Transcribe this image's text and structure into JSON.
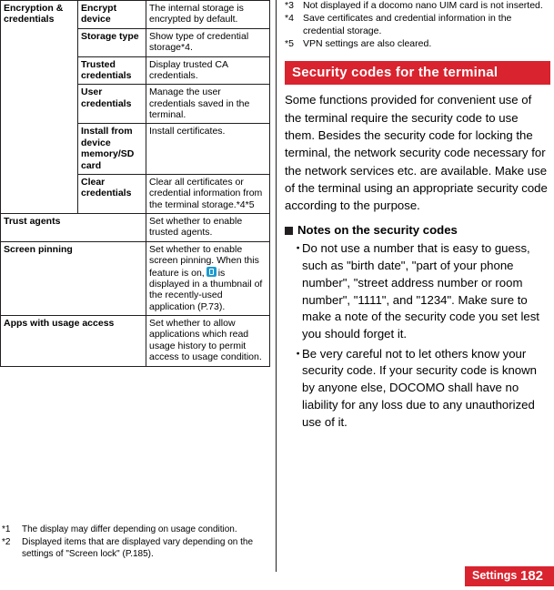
{
  "left_table": {
    "rows": [
      {
        "c1": "Encryption & credentials",
        "c2": "Encrypt device",
        "c3": "The internal storage is encrypted by default."
      },
      {
        "c1": "",
        "c2": "Storage type",
        "c3": "Show type of credential storage*4."
      },
      {
        "c1": "",
        "c2": "Trusted credentials",
        "c3": "Display trusted CA credentials."
      },
      {
        "c1": "",
        "c2": "User credentials",
        "c3": "Manage the user credentials saved in the terminal."
      },
      {
        "c1": "",
        "c2": "Install from device memory/SD card",
        "c3": "Install certificates."
      },
      {
        "c1": "",
        "c2": "Clear credentials",
        "c3": "Clear all certificates or credential information from the terminal storage.*4*5"
      },
      {
        "c1": "Trust agents",
        "c2": "",
        "c3": "Set whether to enable trusted agents."
      },
      {
        "c1": "Screen pinning",
        "c2": "",
        "c3": "Set whether to enable screen pinning. When this feature is on,  is displayed in a thumbnail of the recently-used application (P.73)."
      },
      {
        "c1": "Apps with usage access",
        "c2": "",
        "c3": "Set whether to allow applications which read usage history to permit access to usage condition."
      }
    ]
  },
  "left_footnotes": [
    {
      "mark": "*1",
      "text": "The display may differ depending on usage condition."
    },
    {
      "mark": "*2",
      "text": "Displayed items that are displayed vary depending on the settings of \"Screen lock\" (P.185)."
    }
  ],
  "right_footnotes": [
    {
      "mark": "*3",
      "text": "Not displayed if a docomo nano UIM card is not inserted."
    },
    {
      "mark": "*4",
      "text": "Save certificates and credential information in the credential storage."
    },
    {
      "mark": "*5",
      "text": "VPN settings are also cleared."
    }
  ],
  "section": {
    "heading": "Security codes for the terminal",
    "intro": "Some functions provided for convenient use of the terminal require the security code to use them. Besides the security code for locking the terminal, the network security code necessary for the network services etc. are available. Make use of the terminal using an appropriate security code according to the purpose.",
    "sub_heading": "Notes on the security codes",
    "bullets": [
      "Do not use a number that is easy to guess, such as \"birth date\", \"part of your phone number\", \"street address number or room number\", \"1111\", and \"1234\". Make sure to make a note of the security code you set lest you should forget it.",
      "Be very careful not to let others know your security code. If your security code is known by anyone else, DOCOMO shall have no liability for any loss due to any unauthorized use of it."
    ]
  },
  "footer": {
    "section_title": "Settings",
    "page_number": "182"
  },
  "colors": {
    "accent": "#d9232e",
    "rule": "#231f20",
    "pin_icon": "#1d9bd1"
  }
}
